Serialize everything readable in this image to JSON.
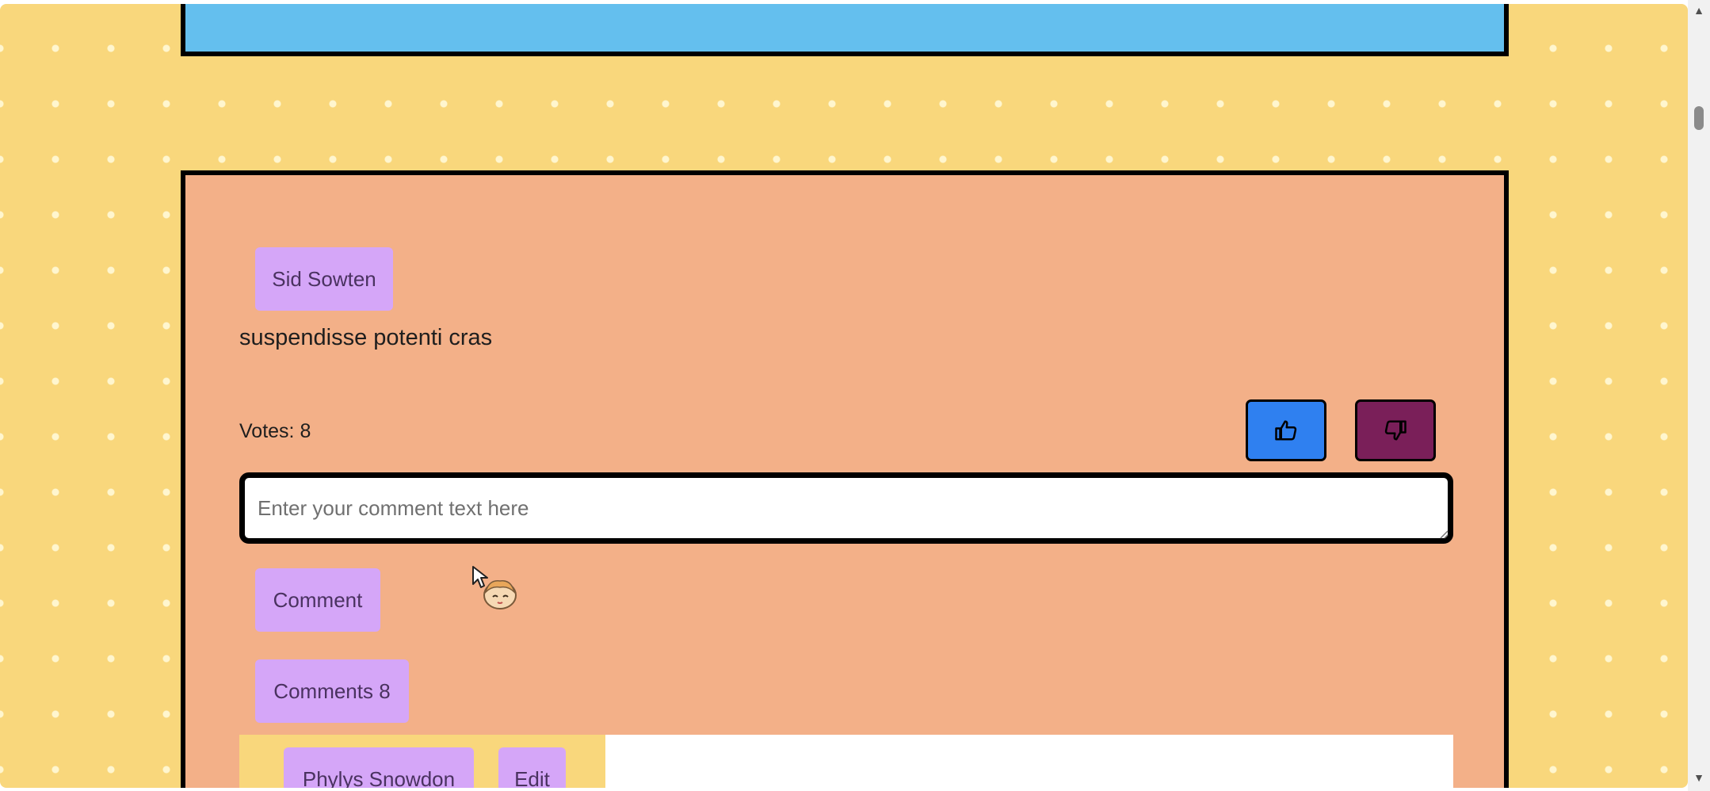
{
  "post": {
    "author": "Sid Sowten",
    "text": "suspendisse potenti cras",
    "votes_label": "Votes: 8",
    "upvote_icon": "thumbs-up-icon",
    "downvote_icon": "thumbs-down-icon"
  },
  "comment_form": {
    "placeholder": "Enter your comment text here",
    "value": "",
    "submit_label": "Comment"
  },
  "comments": {
    "toggle_label": "Comments 8",
    "items": [
      {
        "author": "Phylys Snowdon",
        "edit_label": "Edit"
      }
    ]
  },
  "colors": {
    "page_background": "#f9d77c",
    "top_card": "#64bfee",
    "post_card": "#f3b088",
    "pill_button": "#d5a6f8",
    "upvote_button": "#2f80f0",
    "downvote_button": "#7a1f59"
  }
}
